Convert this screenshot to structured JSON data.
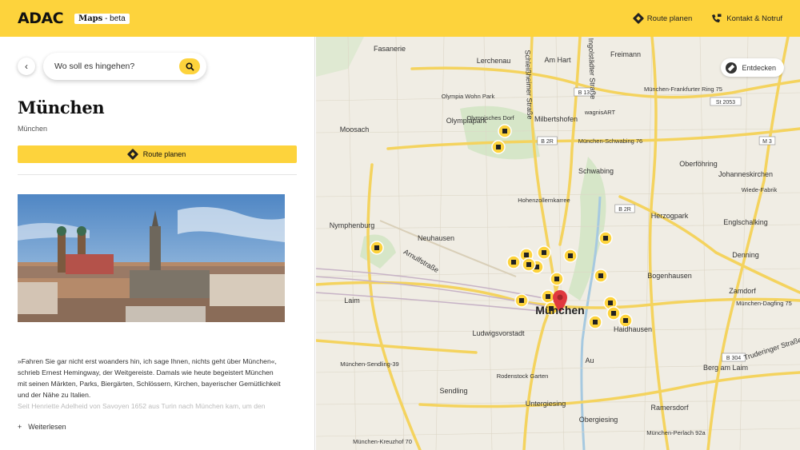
{
  "header": {
    "logo": "ADAC",
    "maps_label": "Maps",
    "beta_label": "- beta",
    "nav": [
      {
        "label": "Route planen",
        "icon": "route-diamond-icon"
      },
      {
        "label": "Kontakt & Notruf",
        "icon": "phone-icon"
      }
    ]
  },
  "sidebar": {
    "search": {
      "placeholder": "Wo soll es hingehen?"
    },
    "title": "München",
    "subtitle": "München",
    "route_button": "Route planen",
    "description_line1": "»Fahren Sie gar nicht erst woanders hin, ich sage Ihnen, nichts geht über München«,",
    "description_line2": "schrieb Ernest Hemingway, der Weitgereiste. Damals wie heute begeistert München",
    "description_line3": "mit seinen Märkten, Parks, Biergärten, Schlössern, Kirchen, bayerischer Gemütlichkeit",
    "description_line4": "und der Nähe zu Italien.",
    "description_fade": "Seit Henriette Adelheid von Savoyen 1652 aus Turin nach München kam, um den",
    "read_more": "Weiterlesen"
  },
  "map": {
    "explore_button": "Entdecken",
    "city_label": "München",
    "labels": [
      {
        "t": "Fasanerie"
      },
      {
        "t": "Lerchenau"
      },
      {
        "t": "Am Hart"
      },
      {
        "t": "Freimann"
      },
      {
        "t": "Olympiapark"
      },
      {
        "t": "Milbertshofen"
      },
      {
        "t": "Moosach"
      },
      {
        "t": "Schwabing"
      },
      {
        "t": "Oberföhring"
      },
      {
        "t": "Johanneskirchen"
      },
      {
        "t": "Nymphenburg"
      },
      {
        "t": "Neuhausen"
      },
      {
        "t": "Herzogpark"
      },
      {
        "t": "Englschalking"
      },
      {
        "t": "Denning"
      },
      {
        "t": "Bogenhausen"
      },
      {
        "t": "Laim"
      },
      {
        "t": "Zamdorf"
      },
      {
        "t": "Ludwigsvorstadt"
      },
      {
        "t": "Haidhausen"
      },
      {
        "t": "Au"
      },
      {
        "t": "Sendling"
      },
      {
        "t": "Untergiesing"
      },
      {
        "t": "Obergiesing"
      },
      {
        "t": "Ramersdorf"
      },
      {
        "t": "Berg am Laim"
      },
      {
        "t": "München-Sendling-39"
      },
      {
        "t": "München-Frankfurter Ring 75"
      },
      {
        "t": "München-Schwabing 76"
      },
      {
        "t": "München-Dagfing 75"
      },
      {
        "t": "München-Perlach 92a"
      },
      {
        "t": "Hohenzollernkarree"
      },
      {
        "t": "Arnulfstraße"
      },
      {
        "t": "Rodenstock Garten"
      },
      {
        "t": "München-Kreuzhof 70"
      },
      {
        "t": "Wiede-Fabrik"
      },
      {
        "t": "Truderinger Straße"
      },
      {
        "t": "Olympia Wohn Park"
      },
      {
        "t": "Olympisches Dorf"
      },
      {
        "t": "wagnisART"
      },
      {
        "t": "Ingolstädter Straße"
      },
      {
        "t": "Schleißheimer Straße"
      }
    ],
    "shields": [
      {
        "t": "B 13"
      },
      {
        "t": "B 2R"
      },
      {
        "t": "B 2R"
      },
      {
        "t": "St 2053"
      },
      {
        "t": "M 3"
      },
      {
        "t": "B 304"
      }
    ]
  },
  "colors": {
    "brand": "#fdd33c",
    "marker": "#e0393e"
  }
}
